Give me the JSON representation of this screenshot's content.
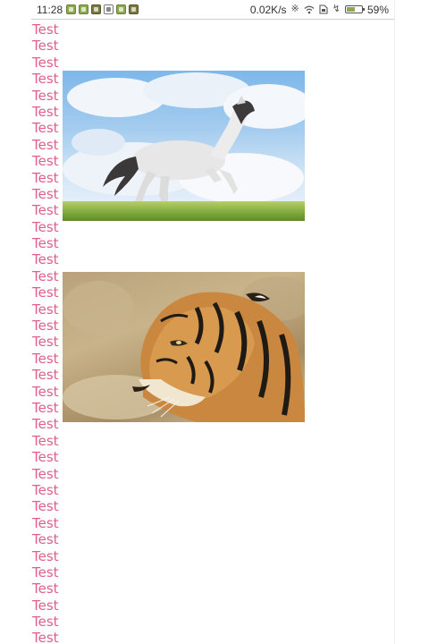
{
  "status_bar": {
    "time": "11:28",
    "network_speed": "0.02K/s",
    "battery_percent": "59%",
    "battery_level": 0.59,
    "icons": [
      "notification-icon",
      "notification-icon",
      "notification-icon",
      "notification-icon",
      "notification-icon",
      "notification-icon",
      "bluetooth-icon",
      "wifi-icon",
      "sim-icon",
      "charging-icon",
      "battery-icon"
    ]
  },
  "content": {
    "lines": [
      "Test",
      "Test",
      "Test",
      "Test",
      "Test",
      "Test",
      "Test",
      "Test",
      "Test",
      "Test",
      "Test",
      "Test",
      "Test",
      "Test",
      "Test",
      "Test",
      "Test",
      "Test",
      "Test",
      "Test",
      "Test",
      "Test",
      "Test",
      "Test",
      "Test",
      "Test",
      "Test",
      "Test",
      "Test",
      "Test",
      "Test",
      "Test",
      "Test",
      "Test",
      "Test",
      "Test",
      "Test",
      "Test",
      "Test"
    ],
    "text_color": "#e0608a",
    "images": [
      "white-horse-image",
      "tiger-image"
    ]
  }
}
